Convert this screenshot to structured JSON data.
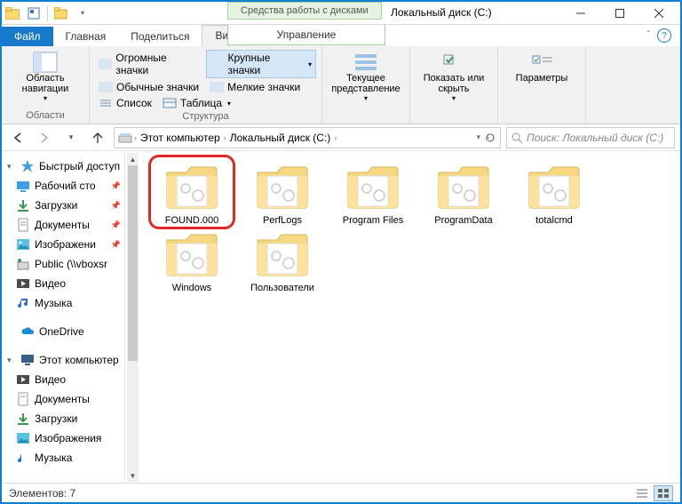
{
  "titlebar": {
    "tools_tab": "Средства работы с дисками",
    "title": "Локальный диск (C:)"
  },
  "tabs": {
    "file": "Файл",
    "home": "Главная",
    "share": "Поделиться",
    "view": "Вид",
    "manage": "Управление"
  },
  "ribbon": {
    "nav_pane": "Область навигации",
    "group_regions": "Области",
    "layout": {
      "huge": "Огромные значки",
      "large": "Крупные значки",
      "normal": "Обычные значки",
      "small": "Мелкие значки",
      "list": "Список",
      "table": "Таблица"
    },
    "group_layout": "Структура",
    "current_view": "Текущее представление",
    "show_hide": "Показать или скрыть",
    "options": "Параметры"
  },
  "breadcrumb": {
    "this_pc": "Этот компьютер",
    "drive": "Локальный диск (C:)"
  },
  "search_placeholder": "Поиск: Локальный диск (C:)",
  "sidebar": {
    "quick": "Быстрый доступ",
    "desktop": "Рабочий сто",
    "downloads": "Загрузки",
    "documents": "Документы",
    "pictures": "Изображени",
    "public": "Public (\\\\vboxsr",
    "videos": "Видео",
    "music": "Музыка",
    "onedrive": "OneDrive",
    "this_pc": "Этот компьютер",
    "videos2": "Видео",
    "documents2": "Документы",
    "downloads2": "Загрузки",
    "pictures2": "Изображения",
    "music2": "Музыка"
  },
  "folders": [
    {
      "name": "FOUND.000",
      "highlight": true
    },
    {
      "name": "PerfLogs"
    },
    {
      "name": "Program Files"
    },
    {
      "name": "ProgramData"
    },
    {
      "name": "totalcmd"
    },
    {
      "name": "Windows"
    },
    {
      "name": "Пользователи"
    }
  ],
  "status": "Элементов: 7"
}
